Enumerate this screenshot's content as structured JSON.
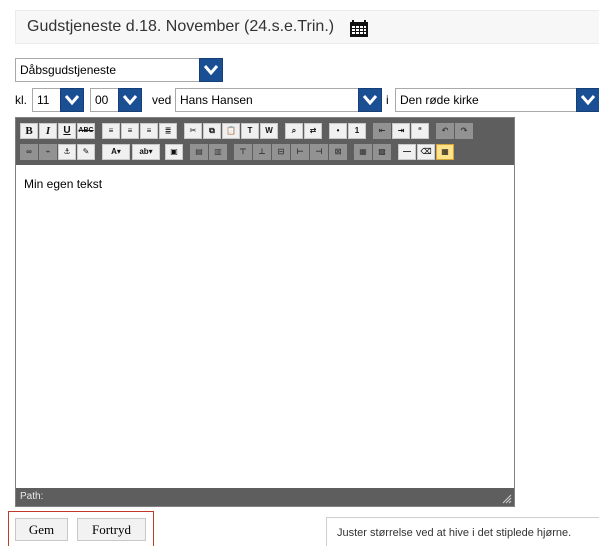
{
  "header": {
    "title": "Gudstjeneste d.18. November (24.s.e.Trin.)",
    "calendar_icon": "calendar-icon"
  },
  "form": {
    "service_type": {
      "selected": "Dåbsgudstjeneste"
    },
    "time_prefix": "kl.",
    "hour": {
      "selected": "11"
    },
    "minute": {
      "selected": "00"
    },
    "by_label": "ved",
    "priest": {
      "selected": "Hans Hansen"
    },
    "in_label": "i",
    "church": {
      "selected": "Den røde kirke"
    }
  },
  "editor": {
    "content": "Min egen tekst",
    "path_label": "Path:",
    "toolbar_row1": [
      "B",
      "I",
      "U",
      "ABC",
      "align-left",
      "align-center",
      "align-right",
      "align-justify",
      "cut",
      "copy",
      "paste",
      "paste-text",
      "paste-word",
      "find",
      "replace",
      "bullets",
      "numbering",
      "outdent",
      "indent",
      "blockquote",
      "undo",
      "redo"
    ],
    "toolbar_row2": [
      "link",
      "unlink",
      "anchor",
      "cleanup",
      "forecolor",
      "backcolor",
      "insert-image",
      "table",
      "row",
      "col",
      "split",
      "merge",
      "delete",
      "hr",
      "eraser",
      "visualaid"
    ]
  },
  "actions": {
    "save_label": "Gem",
    "cancel_label": "Fortryd"
  },
  "hint_text": "Juster størrelse ved at hive i det stiplede hjørne.",
  "colors": {
    "dropdown_arrow": "#1b4f93",
    "toolbar_bg": "#5e5e5e",
    "highlight_frame": "#c0392b"
  }
}
